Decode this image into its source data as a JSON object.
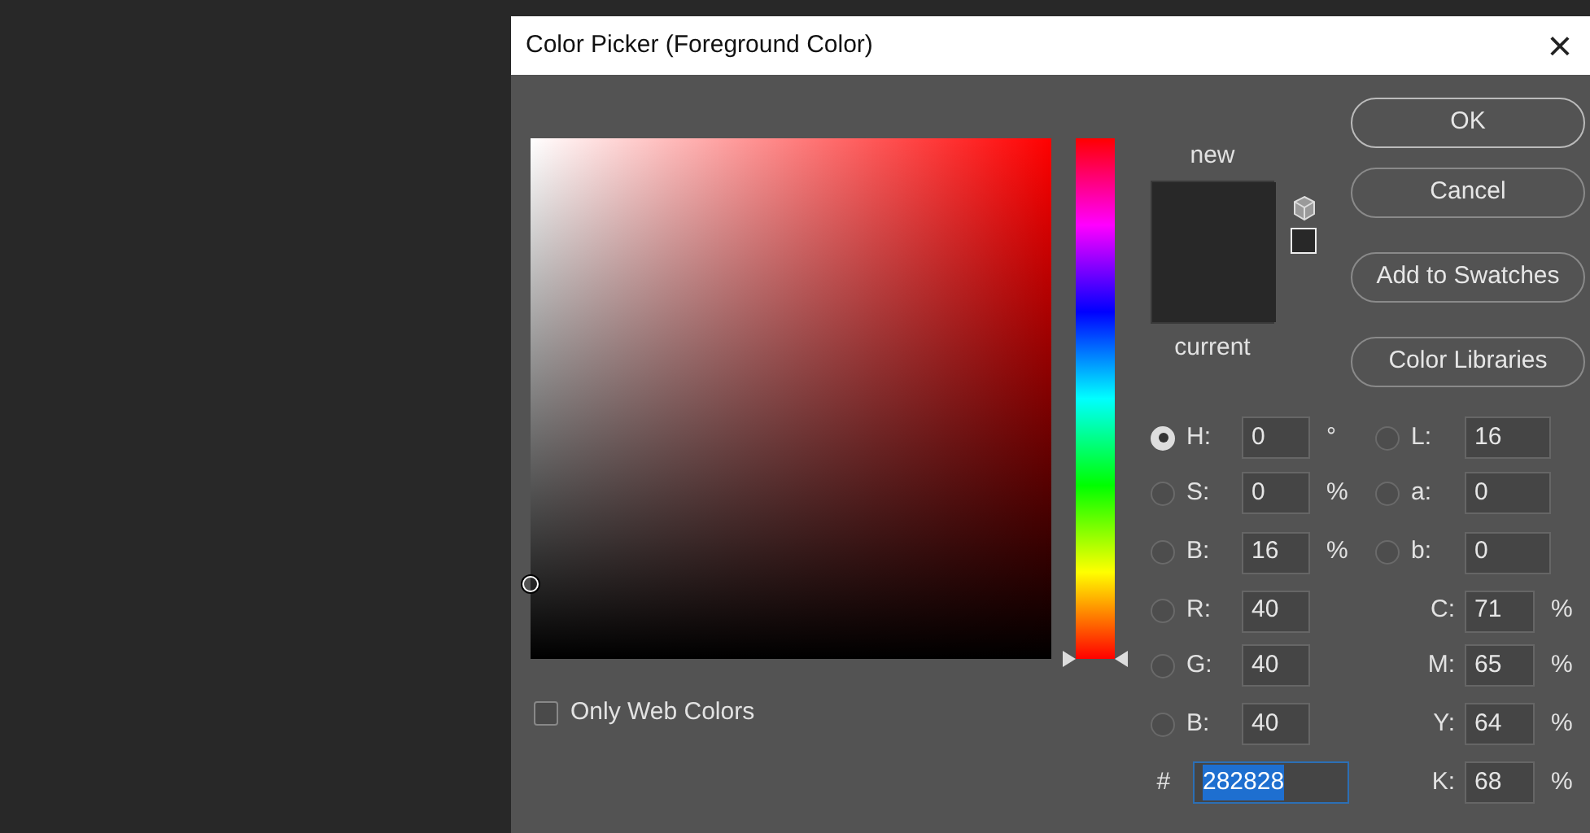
{
  "window": {
    "title": "Color Picker (Foreground Color)",
    "close": "×"
  },
  "preview": {
    "new_label": "new",
    "current_label": "current"
  },
  "hue_slider": {
    "level": 0
  },
  "buttons": [
    {
      "label": "OK",
      "default": true
    },
    {
      "label": "Cancel",
      "default": false
    },
    {
      "label": "Add to Swatches",
      "default": false
    },
    {
      "label": "Color Libraries",
      "default": false
    }
  ],
  "only_web_colors": {
    "label": "Only Web Colors",
    "checked": false
  },
  "rows": [
    {
      "left": {
        "kind": "radio",
        "label": "H:",
        "value": "0",
        "unit": "°",
        "selected": true
      },
      "right": {
        "kind": "radio",
        "label": "L:",
        "value": "16",
        "selected": false
      }
    },
    {
      "left": {
        "kind": "radio",
        "label": "S:",
        "value": "0",
        "unit": "%",
        "selected": false
      },
      "right": {
        "kind": "radio",
        "label": "a:",
        "value": "0",
        "selected": false
      }
    },
    {
      "left": {
        "kind": "radio",
        "label": "B:",
        "value": "16",
        "unit": "%",
        "selected": false
      },
      "right": {
        "kind": "radio",
        "label": "b:",
        "value": "0",
        "selected": false
      }
    },
    {
      "left": {
        "kind": "radio",
        "label": "R:",
        "value": "40",
        "selected": false
      },
      "right": {
        "kind": "plain",
        "label": "C:",
        "value": "71",
        "unit": "%"
      }
    },
    {
      "left": {
        "kind": "radio",
        "label": "G:",
        "value": "40",
        "selected": false
      },
      "right": {
        "kind": "plain",
        "label": "M:",
        "value": "65",
        "unit": "%"
      }
    },
    {
      "left": {
        "kind": "radio",
        "label": "B:",
        "value": "40",
        "selected": false
      },
      "right": {
        "kind": "plain",
        "label": "Y:",
        "value": "64",
        "unit": "%"
      }
    },
    {
      "left": {
        "kind": "hex",
        "label": "#",
        "value": "282828",
        "highlighted": true
      },
      "right": {
        "kind": "plain",
        "label": "K:",
        "value": "68",
        "unit": "%"
      }
    }
  ]
}
